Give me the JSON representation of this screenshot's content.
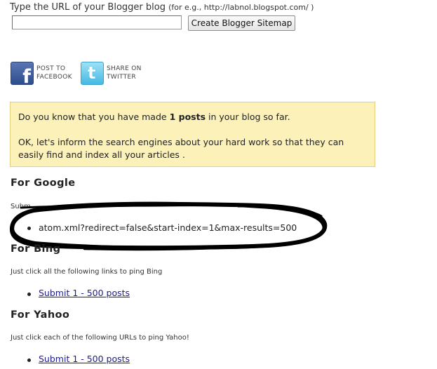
{
  "form": {
    "label": "Type the URL of your Blogger blog",
    "hint": "(for e.g., http://labnol.blogspot.com/ )",
    "input_value": "",
    "button_label": "Create Blogger Sitemap"
  },
  "share": {
    "facebook": {
      "line1": "POST TO",
      "line2": "FACEBOOK",
      "glyph": "f"
    },
    "twitter": {
      "line1": "SHARE ON",
      "line2": "TWITTER",
      "glyph": "t"
    }
  },
  "info": {
    "pre": "Do you know that you have made ",
    "count": "1 posts",
    "post": " in your blog so far.",
    "line2": "OK, let's inform the search engines about your hard work so that they can easily find and index all your articles ."
  },
  "google": {
    "heading": "For Google",
    "instruction_visible": "Subm",
    "url": "atom.xml?redirect=false&start-index=1&max-results=500"
  },
  "bing": {
    "heading": "For Bing",
    "instruction": "Just click all the following links to ping Bing",
    "link": "Submit 1 - 500 posts"
  },
  "yahoo": {
    "heading": "For Yahoo",
    "instruction": "Just click each of the following URLs to ping Yahoo!",
    "link": "Submit 1 - 500 posts"
  },
  "colors": {
    "info_bg": "#fcf1b9",
    "info_border": "#e3d07d",
    "link": "#1a1a9a",
    "facebook": "#3b5998",
    "twitter": "#55c1ea"
  }
}
